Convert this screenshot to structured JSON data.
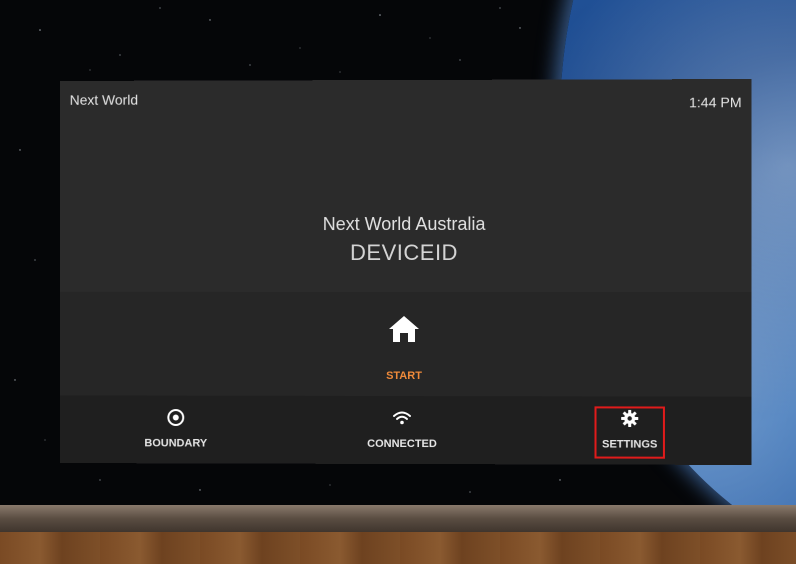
{
  "header": {
    "app_name": "Next World",
    "time": "1:44 PM"
  },
  "device": {
    "organization": "Next World Australia",
    "device_id": "DEVICEID"
  },
  "start": {
    "label": "START",
    "icon": "home-icon",
    "color": "#ef8a3a"
  },
  "nav": {
    "boundary": {
      "label": "BOUNDARY",
      "icon": "target-icon"
    },
    "connected": {
      "label": "CONNECTED",
      "icon": "wifi-icon"
    },
    "settings": {
      "label": "SETTINGS",
      "icon": "gear-icon"
    }
  },
  "highlight_color": "#e01b1b"
}
